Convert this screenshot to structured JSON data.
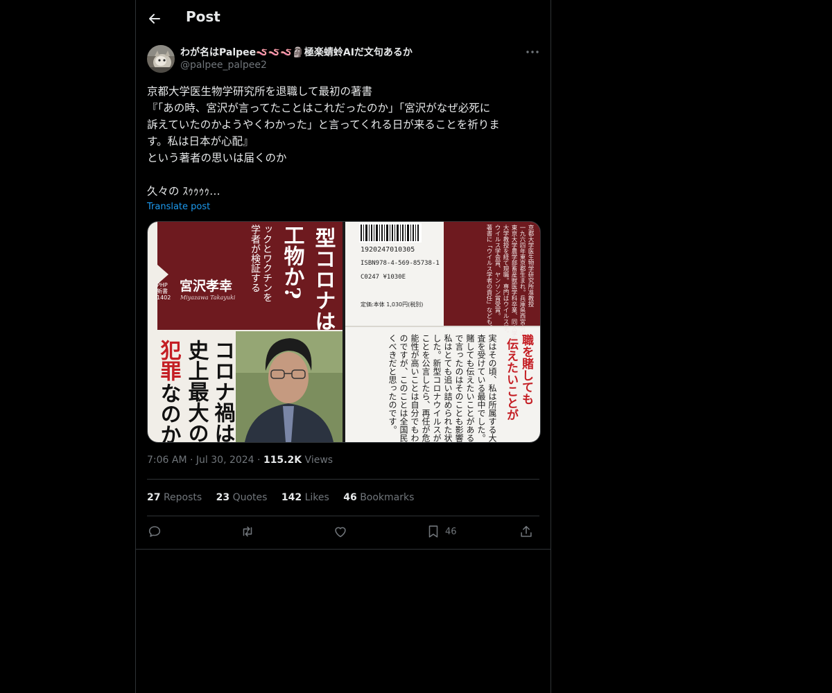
{
  "header": {
    "title": "Post"
  },
  "author": {
    "name": "わが名はPalpee🪱🪱🪱🗿極楽蜻蛉AIだ文句あるか",
    "handle": "@palpee_palpee2"
  },
  "post": {
    "lines": [
      "京都大学医生物学研究所を退職して最初の著書",
      "『「あの時、宮沢が言ってたことはこれだったのか」「宮沢がなぜ必死に",
      "訴えていたのかようやくわかった」と言ってくれる日が来ることを祈りま",
      "す。私は日本が心配』",
      "という著者の思いは届くのか",
      "",
      "久々の ｽｩｩｩｩ…"
    ],
    "translate_label": "Translate post"
  },
  "media": {
    "cover_title_1": "型コロナは",
    "cover_title_2": "工物か?",
    "cover_sub_1": "ックとワクチンを",
    "cover_sub_2": "学者が検証する",
    "series_1": "PHP",
    "series_2": "新書",
    "series_3": "1402",
    "author_jp": "宮沢孝幸",
    "author_en": "Miyazawa Takayuki",
    "band_red": "犯罪",
    "band_black_1": "コロナ禍は",
    "band_black_2": "史上最大の",
    "band_black_3": "なのか",
    "barcode_num": "1920247010305",
    "isbn": "ISBN978-4-569-85738-1",
    "code": "C0247 ¥1030E",
    "price": "定価:本体 1,030円(税別)",
    "bio_cols": [
      "京都大学医生物学研究所准教授",
      "一九六四年東京都生まれ。兵庫県西宮市出身",
      "東京大学農学部畜産獣医学科卒業、同大学院",
      "大学教授を経て現職。専門はウイルス学。",
      "ウイルス学会賞、ヤンソン賞受賞。",
      "著書に「ウイルス学者の責任」なども。"
    ],
    "headline_1": "職を賭しても",
    "headline_2": "伝えたいことが",
    "body_cols": [
      "実はその頃、私は所属する大",
      "査を受けている最中でした。",
      "賭しても伝えたいことがある",
      "で言ったのはそのことも影響し",
      "私はとても追い詰められた状",
      "した。新型コロナウイルスが",
      "ことを公言したら、再任が危",
      "能性が高いことは自分でもわ",
      "のですが、このことは全国民",
      "くべきだと思ったのです。"
    ]
  },
  "meta": {
    "time": "7:06 AM",
    "date": "Jul 30, 2024",
    "views_count": "115.2K",
    "views_label": "Views"
  },
  "stats": [
    {
      "num": "27",
      "label": "Reposts"
    },
    {
      "num": "23",
      "label": "Quotes"
    },
    {
      "num": "142",
      "label": "Likes"
    },
    {
      "num": "46",
      "label": "Bookmarks"
    }
  ],
  "actions": {
    "bookmark_count": "46"
  },
  "colors": {
    "background": "#000000",
    "border": "#2f3336",
    "text": "#e7e9ea",
    "muted": "#71767b",
    "link": "#1d9bf0",
    "cover_red": "#6e1a1f",
    "band_red": "#c41e24"
  }
}
